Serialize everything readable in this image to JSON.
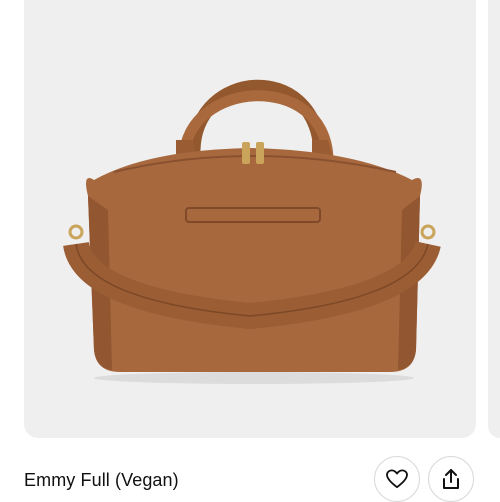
{
  "product": {
    "title": "Emmy Full (Vegan)",
    "image_alt": "Cognac vegan leather weekender bag"
  },
  "actions": {
    "favorite_icon": "heart-icon",
    "share_icon": "share-icon"
  },
  "colors": {
    "card_bg": "#efefef",
    "bag": "#a7683d",
    "bag_dark": "#7c4826",
    "zipper": "#c9a45a"
  }
}
